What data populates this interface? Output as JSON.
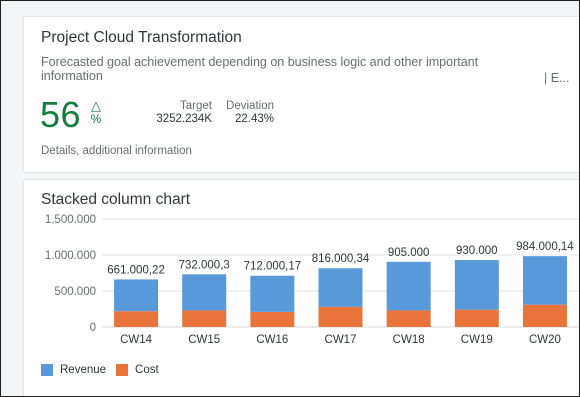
{
  "kpi_card": {
    "title": "Project Cloud Transformation",
    "subtitle": "Forecasted goal achievement depending on business logic and other important information",
    "unit_truncated": "| E...",
    "value": "56",
    "indicator": "△",
    "indicator_name": "triangle-up-icon",
    "scale": "%",
    "target_label": "Target",
    "target_value": "3252.234K",
    "deviation_label": "Deviation",
    "deviation_value": "22.43%",
    "footer": "Details, additional information",
    "value_color": "#107e3e"
  },
  "chart_card": {
    "title": "Stacked column chart",
    "legend": [
      {
        "name": "Revenue",
        "color": "#5899da"
      },
      {
        "name": "Cost",
        "color": "#e8743b"
      }
    ]
  },
  "chart_data": {
    "type": "bar",
    "stacked": true,
    "categories": [
      "CW14",
      "CW15",
      "CW16",
      "CW17",
      "CW18",
      "CW19",
      "CW20"
    ],
    "series": [
      {
        "name": "Cost",
        "color": "#e8743b",
        "values": [
          220000,
          230000,
          210000,
          280000,
          230000,
          240000,
          310000
        ]
      },
      {
        "name": "Revenue",
        "color": "#5899da",
        "values": [
          441000.22,
          502000.3,
          502000.17,
          536000.34,
          675000,
          690000,
          674000.14
        ]
      }
    ],
    "total_labels": [
      "661.000,22",
      "732.000,3",
      "712.000,17",
      "816.000,34",
      "905.000",
      "930.000",
      "984.000,14"
    ],
    "yticks": [
      0,
      500000,
      1000000,
      1500000
    ],
    "ytick_labels": [
      "0",
      "500.000",
      "1.000.000",
      "1.500.000"
    ],
    "ylim": [
      0,
      1500000
    ],
    "grid": true,
    "legend_position": "bottom-left"
  }
}
